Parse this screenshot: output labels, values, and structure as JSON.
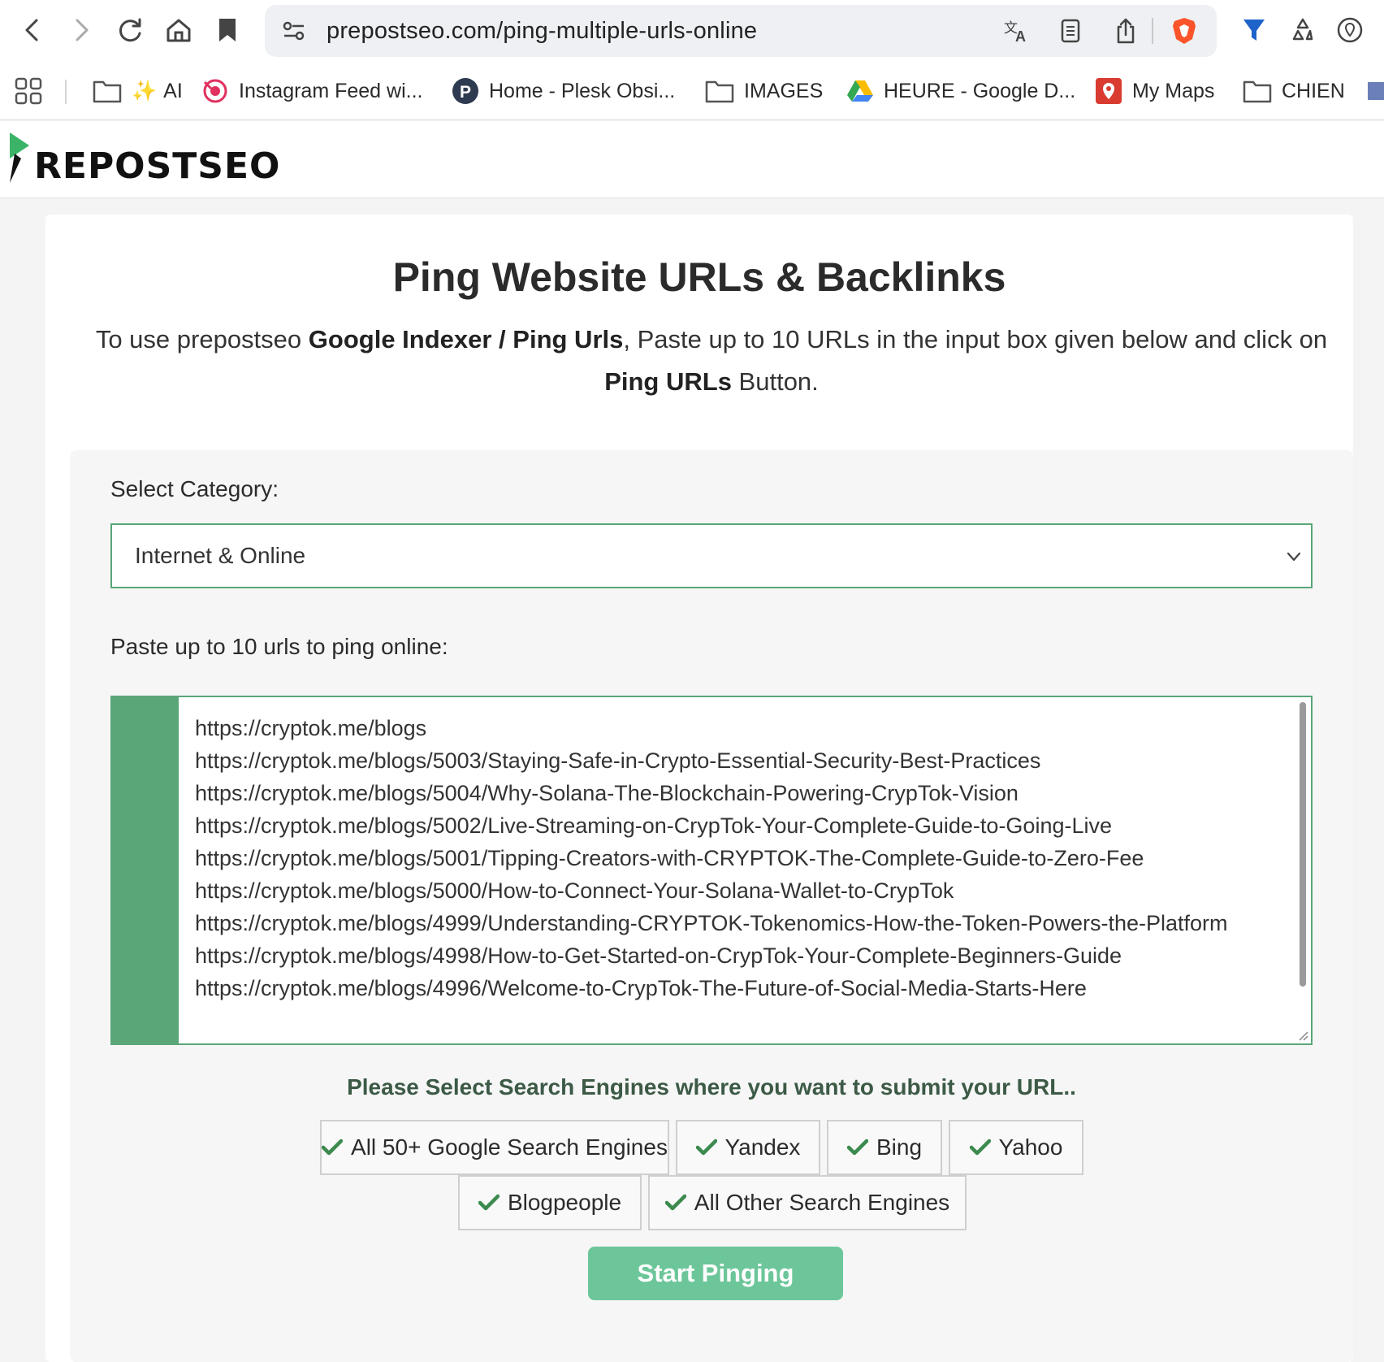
{
  "browser": {
    "url": "prepostseo.com/ping-multiple-urls-online",
    "brand_color": "#fb542b"
  },
  "bookmarks": [
    {
      "label": "AI",
      "icon": "folder-icon"
    },
    {
      "label": "Instagram Feed wi...",
      "icon": "instagram-feed-icon"
    },
    {
      "label": "Home - Plesk Obsi...",
      "icon": "plesk-icon"
    },
    {
      "label": "IMAGES",
      "icon": "folder-icon"
    },
    {
      "label": "HEURE - Google D...",
      "icon": "google-drive-icon"
    },
    {
      "label": "My Maps",
      "icon": "my-maps-icon"
    },
    {
      "label": "CHIEN",
      "icon": "folder-icon"
    }
  ],
  "site": {
    "logo_text": "REPOSTSEO",
    "accent_color": "#5aa678"
  },
  "page": {
    "title": "Ping Website URLs & Backlinks",
    "intro": {
      "part1": "To use prepostseo ",
      "bold1": "Google Indexer / Ping Urls",
      "part2": ", Paste up to 10 URLs in the input box given below and click on ",
      "bold2": "Ping URLs",
      "part3": " Button."
    }
  },
  "form": {
    "category_label": "Select Category:",
    "category_value": "Internet & Online",
    "urls_label": "Paste up to 10 urls to ping online:",
    "urls": [
      "https://cryptok.me/blogs",
      "https://cryptok.me/blogs/5003/Staying-Safe-in-Crypto-Essential-Security-Best-Practices",
      "https://cryptok.me/blogs/5004/Why-Solana-The-Blockchain-Powering-CrypTok-Vision",
      "https://cryptok.me/blogs/5002/Live-Streaming-on-CrypTok-Your-Complete-Guide-to-Going-Live",
      "https://cryptok.me/blogs/5001/Tipping-Creators-with-CRYPTOK-The-Complete-Guide-to-Zero-Fee",
      "https://cryptok.me/blogs/5000/How-to-Connect-Your-Solana-Wallet-to-CrypTok",
      "https://cryptok.me/blogs/4999/Understanding-CRYPTOK-Tokenomics-How-the-Token-Powers-the-Platform",
      "https://cryptok.me/blogs/4998/How-to-Get-Started-on-CrypTok-Your-Complete-Beginners-Guide",
      "https://cryptok.me/blogs/4996/Welcome-to-CrypTok-The-Future-of-Social-Media-Starts-Here"
    ],
    "engines_label": "Please Select Search Engines where you want to submit your URL..",
    "engines": [
      {
        "label": "All 50+ Google Search Engines",
        "checked": true
      },
      {
        "label": "Yandex",
        "checked": true
      },
      {
        "label": "Bing",
        "checked": true
      },
      {
        "label": "Yahoo",
        "checked": true
      },
      {
        "label": "Blogpeople",
        "checked": true
      },
      {
        "label": "All Other Search Engines",
        "checked": true
      }
    ],
    "submit_label": "Start Pinging"
  }
}
